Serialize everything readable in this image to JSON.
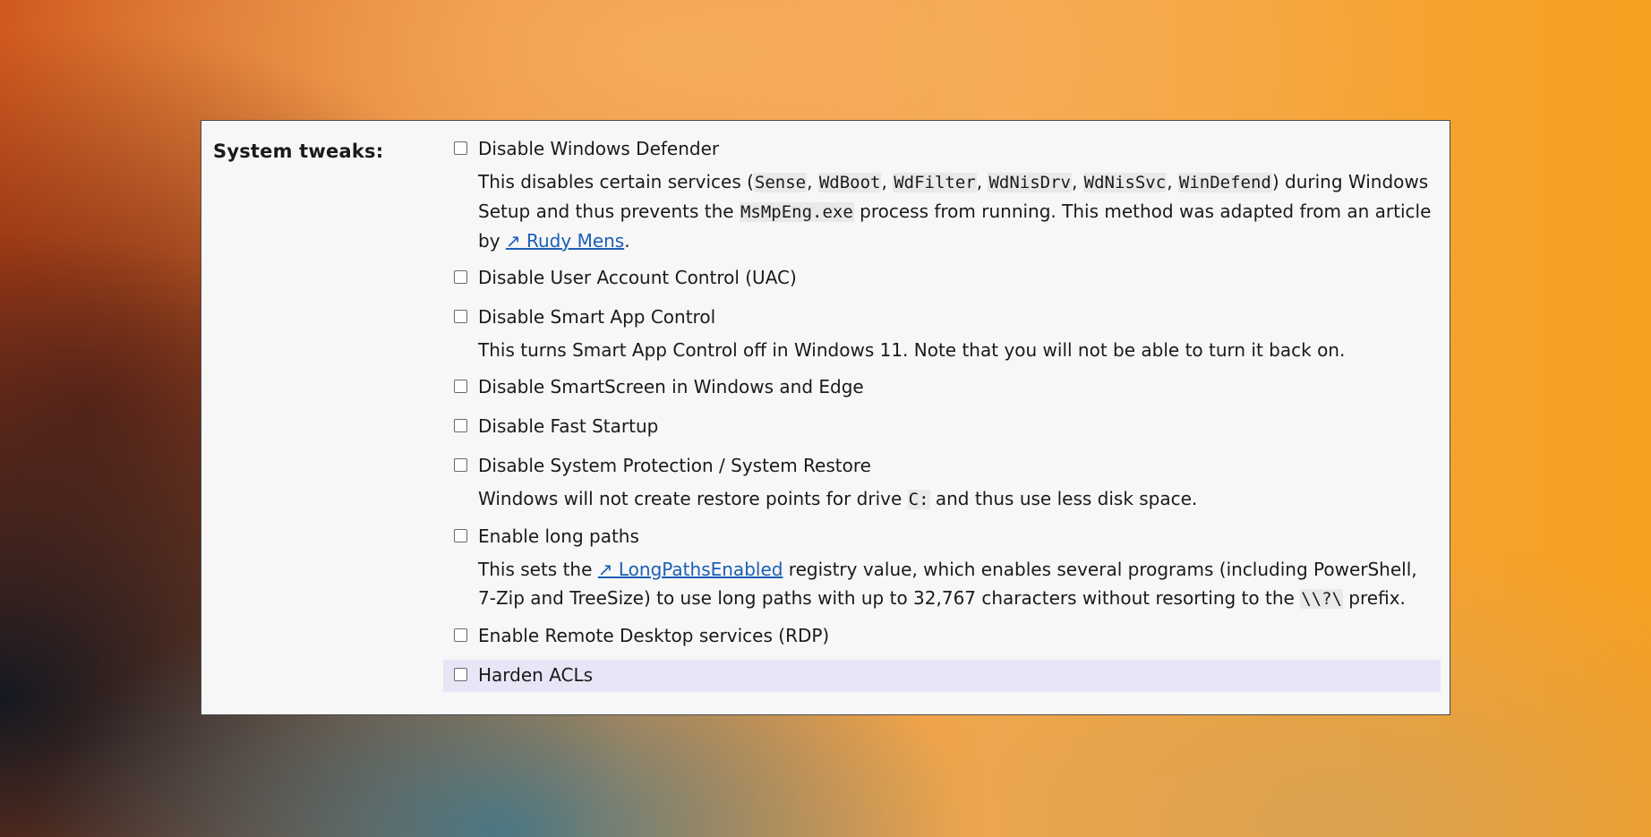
{
  "section": {
    "label": "System tweaks:"
  },
  "options": [
    {
      "label": "Disable Windows Defender",
      "desc": {
        "t1": "This disables certain services (",
        "c1": "Sense",
        "t2": ", ",
        "c2": "WdBoot",
        "t3": ", ",
        "c3": "WdFilter",
        "t4": ", ",
        "c4": "WdNisDrv",
        "t5": ", ",
        "c5": "WdNisSvc",
        "t6": ", ",
        "c6": "WinDefend",
        "t7": ") during Windows Setup and thus prevents the ",
        "c7": "MsMpEng.exe",
        "t8": " process from running. This method was adapted from an article by ",
        "link": "↗ Rudy Mens",
        "t9": "."
      }
    },
    {
      "label": "Disable User Account Control (UAC)"
    },
    {
      "label": "Disable Smart App Control",
      "desc": "This turns Smart App Control off in Windows 11. Note that you will not be able to turn it back on."
    },
    {
      "label": "Disable SmartScreen in Windows and Edge"
    },
    {
      "label": "Disable Fast Startup"
    },
    {
      "label": "Disable System Protection / System Restore",
      "desc": {
        "t1": "Windows will not create restore points for drive ",
        "c1": "C:",
        "t2": " and thus use less disk space."
      }
    },
    {
      "label": "Enable long paths",
      "desc": {
        "t1": "This sets the ",
        "link": "↗ LongPathsEnabled",
        "t2": " registry value, which enables several programs (including PowerShell, 7‑Zip and TreeSize) to use long paths with up to 32,767 characters without resorting to the ",
        "c1": "\\\\?\\",
        "t3": " prefix."
      }
    },
    {
      "label": "Enable Remote Desktop services (RDP)"
    },
    {
      "label": "Harden ACLs"
    }
  ]
}
